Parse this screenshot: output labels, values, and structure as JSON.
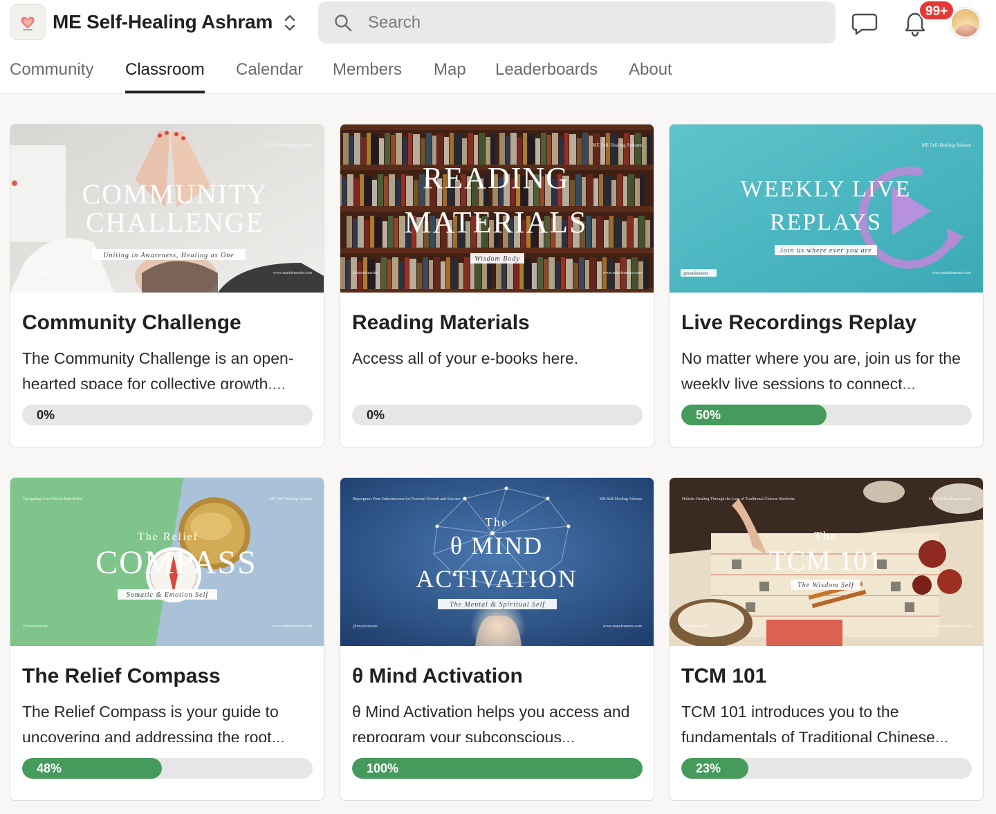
{
  "header": {
    "app_title": "ME Self-Healing Ashram",
    "search_placeholder": "Search",
    "notification_count": "99+"
  },
  "nav": {
    "tabs": [
      {
        "label": "Community",
        "active": false
      },
      {
        "label": "Classroom",
        "active": true
      },
      {
        "label": "Calendar",
        "active": false
      },
      {
        "label": "Members",
        "active": false
      },
      {
        "label": "Map",
        "active": false
      },
      {
        "label": "Leaderboards",
        "active": false
      },
      {
        "label": "About",
        "active": false
      }
    ]
  },
  "courses": [
    {
      "title": "Community Challenge",
      "description": "The Community Challenge is an open-hearted space for collective growth....",
      "progress_label": "0%",
      "progress": 0,
      "thumb": {
        "title_lines": [
          "COMMUNITY",
          "CHALLENGE"
        ],
        "subtitle": "Uniting in Awareness, Healing as One",
        "brand": "ME Self-Healing Ashram",
        "handle": "@maielements",
        "site": "www.maielements.com"
      }
    },
    {
      "title": "Reading Materials",
      "description": "Access all of your e-books here.",
      "progress_label": "0%",
      "progress": 0,
      "thumb": {
        "title_lines": [
          "READING",
          "MATERIALS"
        ],
        "subtitle": "Wisdom Body",
        "brand": "ME Self-Healing Ashram",
        "handle": "@maielements",
        "site": "www.maielements.com"
      }
    },
    {
      "title": "Live Recordings Replay",
      "description": "No matter where you are, join us for the weekly live sessions to connect...",
      "progress_label": "50%",
      "progress": 0.5,
      "thumb": {
        "title_lines": [
          "WEEKLY LIVE",
          "REPLAYS"
        ],
        "subtitle": "Join us where ever you are",
        "brand": "ME Self-Healing Ashram",
        "handle": "@maielements",
        "site": "www.maielements.com"
      }
    },
    {
      "title": "The Relief Compass",
      "description": "The Relief Compass is your guide to uncovering and addressing the root...",
      "progress_label": "48%",
      "progress": 0.48,
      "thumb": {
        "kicker": "The Relief",
        "title_lines": [
          "COMPASS"
        ],
        "subtitle": "Somatic & Emotion Self",
        "tagline": "Navigating Your Path to Pain Relief",
        "brand": "ME Self-Healing Ashram",
        "handle": "@maielements",
        "site": "www.maielements.com"
      }
    },
    {
      "title": "θ Mind Activation",
      "description": "θ Mind Activation helps you access and reprogram your subconscious...",
      "progress_label": "100%",
      "progress": 1,
      "thumb": {
        "kicker": "The",
        "title_lines": [
          "θ MIND",
          "ACTIVATION"
        ],
        "subtitle": "The Mental & Spiritual Self",
        "tagline": "Reprogram Your Subconscious for Personal Growth and Success",
        "brand": "ME Self-Healing Ashram",
        "handle": "@maielements",
        "site": "www.maielements.com"
      }
    },
    {
      "title": "TCM 101",
      "description": "TCM 101 introduces you to the fundamentals of Traditional Chinese...",
      "progress_label": "23%",
      "progress": 0.23,
      "thumb": {
        "kicker": "The",
        "title_lines": [
          "TCM 101"
        ],
        "subtitle": "The Wisdom Self",
        "tagline": "Holistic Healing Through the Lens of Traditional Chinese Medicine",
        "brand": "ME Self-Healing Ashram",
        "handle": "@maielements",
        "site": "www.maielements.com"
      }
    }
  ],
  "colors": {
    "progress_fill": "#469a5c",
    "progress_track": "#e6e6e6",
    "badge": "#e53935",
    "active_tab": "#202124"
  },
  "icons": [
    "heart-logo-icon",
    "chevron-up-down-icon",
    "search-icon",
    "chat-icon",
    "bell-icon"
  ]
}
